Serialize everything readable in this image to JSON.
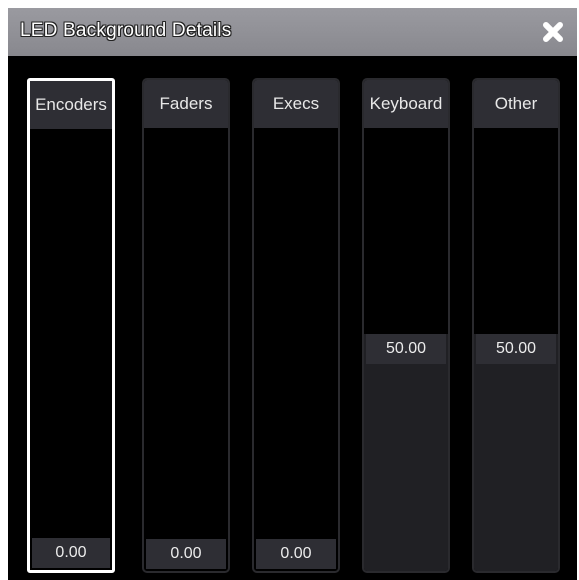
{
  "window": {
    "title": "LED Background Details",
    "close_icon": "close-x-icon"
  },
  "columns": [
    {
      "label": "Encoders",
      "value": "0.00",
      "level": 0.0,
      "selected": true
    },
    {
      "label": "Faders",
      "value": "0.00",
      "level": 0.0,
      "selected": false
    },
    {
      "label": "Execs",
      "value": "0.00",
      "level": 0.0,
      "selected": false
    },
    {
      "label": "Keyboard",
      "value": "50.00",
      "level": 0.5,
      "selected": false
    },
    {
      "label": "Other",
      "value": "50.00",
      "level": 0.5,
      "selected": false
    }
  ],
  "colors": {
    "background": "#000000",
    "titlebar": "#8f8f95",
    "column_header": "#2e2e34",
    "column_fill": "#202024",
    "selected_border": "#ffffff"
  }
}
